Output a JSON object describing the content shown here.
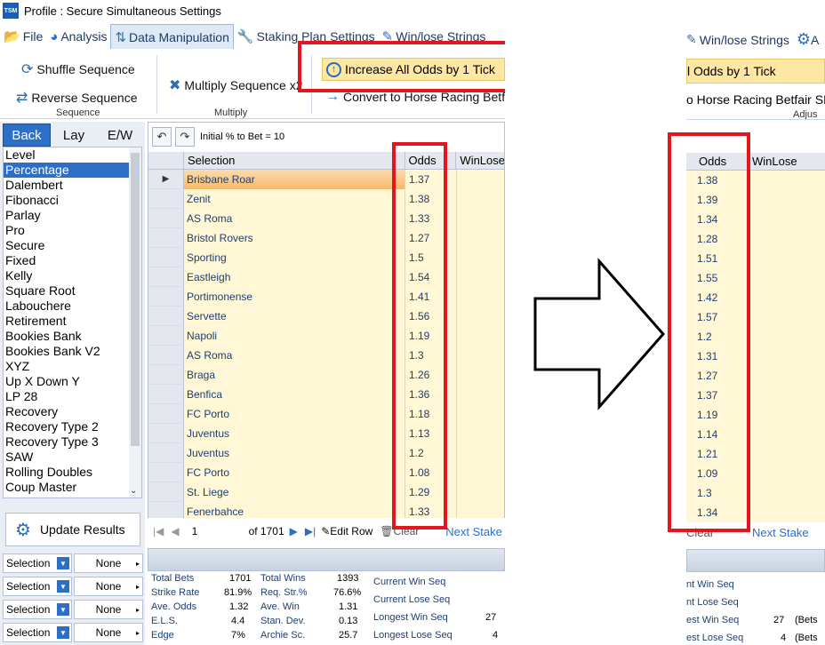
{
  "title": "Profile : Secure Simultaneous Settings",
  "app_logo": "TSM",
  "tabs": [
    {
      "label": "File",
      "icon": "folder-icon"
    },
    {
      "label": "Analysis",
      "icon": "pie-chart-icon"
    },
    {
      "label": "Data Manipulation",
      "icon": "sort-numeric-icon"
    },
    {
      "label": "Staking Plan Settings",
      "icon": "wrench-icon"
    },
    {
      "label": "Win/lose Strings",
      "icon": "edit-icon"
    }
  ],
  "ribbon": {
    "shuffle": "Shuffle Sequence",
    "reverse": "Reverse Sequence",
    "sequence_group": "Sequence",
    "multiply": "Multiply Sequence x2",
    "multiply_group": "Multiply",
    "increase": "Increase All Odds by 1 Tick",
    "convert": "Convert to Horse Racing Betfa"
  },
  "bet_tabs": [
    "Back",
    "Lay",
    "E/W"
  ],
  "methods": [
    "Level",
    "Percentage",
    "Dalembert",
    "Fibonacci",
    "Parlay",
    "Pro",
    "Secure",
    "Fixed",
    "Kelly",
    "Square Root",
    "Labouchere",
    "Retirement",
    "Bookies Bank",
    "Bookies Bank V2",
    "XYZ",
    "Up X Down Y",
    "LP 28",
    "Recovery",
    "Recovery Type 2",
    "Recovery Type 3",
    "SAW",
    "Rolling Doubles",
    "Coup Master"
  ],
  "update_results": "Update Results",
  "selection_rows": [
    {
      "left": "Selection",
      "right": "None"
    },
    {
      "left": "Selection",
      "right": "None"
    },
    {
      "left": "Selection",
      "right": "None"
    },
    {
      "left": "Selection",
      "right": "None"
    }
  ],
  "grid": {
    "initial_text": "Initial % to Bet = 10",
    "columns": [
      "Selection",
      "Odds",
      "WinLose"
    ],
    "rows": [
      {
        "selection": "Brisbane Roar",
        "odds": "1.37"
      },
      {
        "selection": "Zenit",
        "odds": "1.38"
      },
      {
        "selection": "AS Roma",
        "odds": "1.33"
      },
      {
        "selection": "Bristol Rovers",
        "odds": "1.27"
      },
      {
        "selection": "Sporting",
        "odds": "1.5"
      },
      {
        "selection": "Eastleigh",
        "odds": "1.54"
      },
      {
        "selection": "Portimonense",
        "odds": "1.41"
      },
      {
        "selection": "Servette",
        "odds": "1.56"
      },
      {
        "selection": "Napoli",
        "odds": "1.19"
      },
      {
        "selection": "AS Roma",
        "odds": "1.3"
      },
      {
        "selection": "Braga",
        "odds": "1.26"
      },
      {
        "selection": "Benfica",
        "odds": "1.36"
      },
      {
        "selection": "FC Porto",
        "odds": "1.18"
      },
      {
        "selection": "Juventus",
        "odds": "1.13"
      },
      {
        "selection": "Juventus",
        "odds": "1.2"
      },
      {
        "selection": "FC Porto",
        "odds": "1.08"
      },
      {
        "selection": "St. Liege",
        "odds": "1.29"
      },
      {
        "selection": "Fenerbahce",
        "odds": "1.33"
      }
    ]
  },
  "pager": {
    "page": "1",
    "of": "of 1701",
    "edit_row": "Edit Row",
    "clear": "Clear",
    "next_stake": "Next Stake"
  },
  "stats": {
    "total_bets_l": "Total Bets",
    "total_bets_v": "1701",
    "strike_rate_l": "Strike Rate",
    "strike_rate_v": "81.9%",
    "ave_odds_l": "Ave. Odds",
    "ave_odds_v": "1.32",
    "els_l": "E.L.S.",
    "els_v": "4.4",
    "edge_l": "Edge",
    "edge_v": "7%",
    "total_wins_l": "Total Wins",
    "total_wins_v": "1393",
    "req_str_l": "Req. Str.%",
    "req_str_v": "76.6%",
    "ave_win_l": "Ave. Win",
    "ave_win_v": "1.31",
    "stan_dev_l": "Stan. Dev.",
    "stan_dev_v": "0.13",
    "archie_l": "Archie Sc.",
    "archie_v": "25.7",
    "cur_win_l": "Current Win Seq",
    "cur_lose_l": "Current Lose Seq",
    "long_win_l": "Longest Win Seq",
    "long_win_v": "27",
    "long_lose_l": "Longest Lose Seq",
    "long_lose_v": "4"
  },
  "right_panel": {
    "tab": "Win/lose Strings",
    "tab_partial": "A",
    "increase_partial": "l Odds by 1 Tick",
    "convert_partial": "o Horse Racing Betfair SP",
    "adjust_partial": "Adjus",
    "columns": [
      "Odds",
      "WinLose"
    ],
    "odds": [
      "1.38",
      "1.39",
      "1.34",
      "1.28",
      "1.51",
      "1.55",
      "1.42",
      "1.57",
      "1.2",
      "1.31",
      "1.27",
      "1.37",
      "1.19",
      "1.14",
      "1.21",
      "1.09",
      "1.3",
      "1.34"
    ],
    "clear": "Clear",
    "next_stake": "Next Stake",
    "cur_win": "nt Win Seq",
    "cur_lose": "nt Lose Seq",
    "long_win": "est Win Seq",
    "long_win_v": "27",
    "long_win_suffix": "(Bets",
    "long_lose": "est Lose Seq",
    "long_lose_v": "4",
    "long_lose_suffix": "(Bets"
  },
  "accent_color": "#2d6fc7",
  "highlight_color": "#e3151f"
}
